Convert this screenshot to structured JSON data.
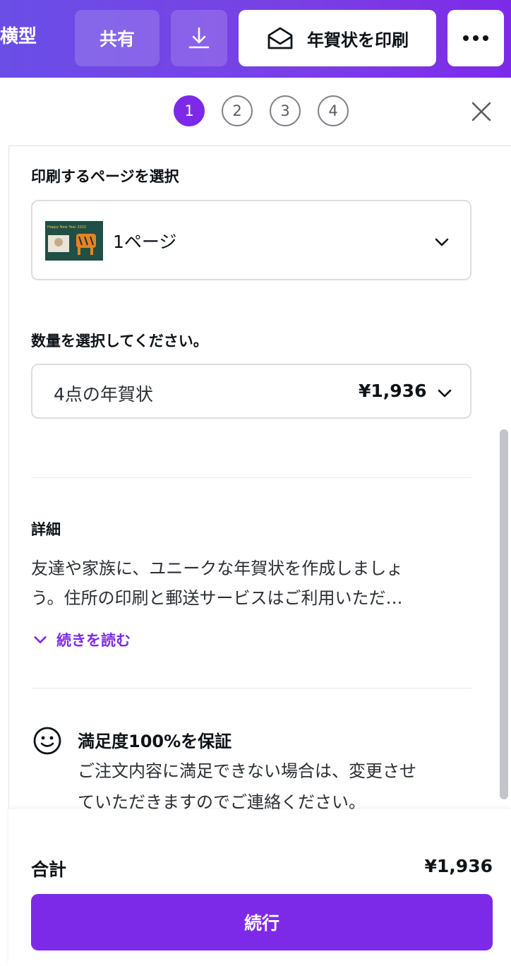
{
  "topbar": {
    "title": "横型",
    "share_label": "共有",
    "download_icon": "download-icon",
    "print_label": "年賀状を印刷",
    "print_icon": "envelope-icon",
    "more_icon": "more-horizontal-icon"
  },
  "stepper": {
    "steps": [
      "1",
      "2",
      "3",
      "4"
    ],
    "active_step": "1",
    "close_icon": "close-icon"
  },
  "page_select": {
    "label": "印刷するページを選択",
    "value": "1ページ",
    "thumbnail_text": "Happy New Year  2022"
  },
  "quantity": {
    "label": "数量を選択してください。",
    "name": "4点の年賀状",
    "price": "¥1,936"
  },
  "details": {
    "heading": "詳細",
    "line1": "友達や家族に、ユニークな年賀状を作成しましょ",
    "line2": "う。住所の印刷と郵送サービスはご利用いただ…",
    "read_more": "続きを読む"
  },
  "guarantee": {
    "title": "満足度100%を保証",
    "line1": "ご注文内容に満足できない場合は、変更させ",
    "line2": "ていただきますのでご連絡ください。",
    "icon": "smiley-icon"
  },
  "footer": {
    "total_label": "合計",
    "total_value": "¥1,936",
    "continue_label": "続行"
  },
  "colors": {
    "accent": "#7d2ae8",
    "topbar_start": "#6a4ee6",
    "topbar_end": "#7d2ae8"
  }
}
